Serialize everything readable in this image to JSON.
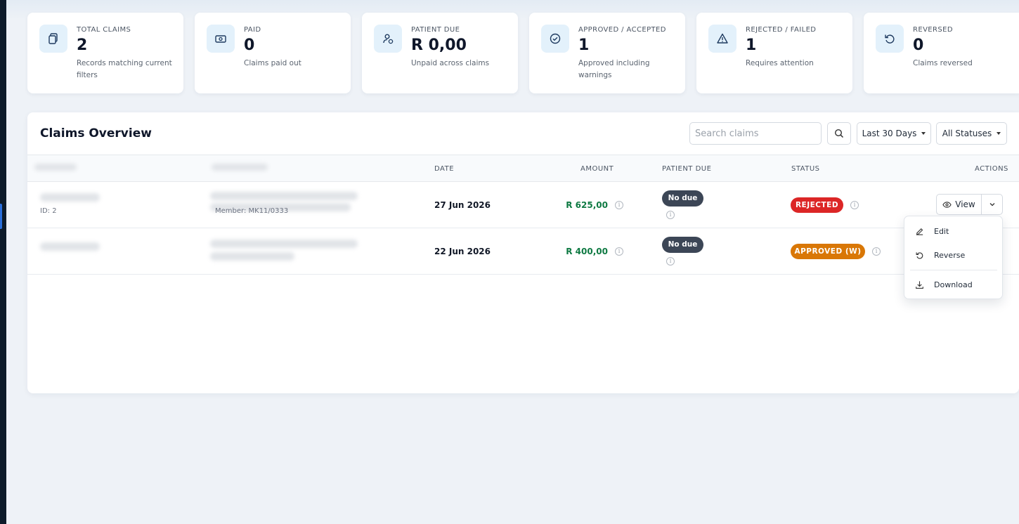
{
  "stats": [
    {
      "label": "TOTAL CLAIMS",
      "value": "2",
      "sub": "Records matching current filters",
      "icon": "copy-icon"
    },
    {
      "label": "PAID",
      "value": "0",
      "sub": "Claims paid out",
      "icon": "cash-icon"
    },
    {
      "label": "PATIENT DUE",
      "value": "R 0,00",
      "sub": "Unpaid across claims",
      "icon": "patient-icon"
    },
    {
      "label": "APPROVED / ACCEPTED",
      "value": "1",
      "sub": "Approved including warnings",
      "icon": "check-circle-icon"
    },
    {
      "label": "REJECTED / FAILED",
      "value": "1",
      "sub": "Requires attention",
      "icon": "warning-icon"
    },
    {
      "label": "REVERSED",
      "value": "0",
      "sub": "Claims reversed",
      "icon": "reverse-icon"
    }
  ],
  "panel": {
    "title": "Claims Overview",
    "search_placeholder": "Search claims",
    "date_filter": "Last 30 Days",
    "status_filter": "All Statuses"
  },
  "table": {
    "columns": {
      "date": "DATE",
      "amount": "AMOUNT",
      "patient_due": "PATIENT DUE",
      "status": "STATUS",
      "actions": "ACTIONS"
    },
    "rows": [
      {
        "id_text": "ID: 2",
        "member_text": "Member: MK11/0333",
        "date": "27 Jun 2026",
        "amount": "R 625,00",
        "patient_due": "No due",
        "status": "REJECTED",
        "status_color": "#dc2626"
      },
      {
        "id_text": "",
        "member_text": "",
        "date": "22 Jun 2026",
        "amount": "R 400,00",
        "patient_due": "No due",
        "status": "APPROVED (W)",
        "status_color": "#d97706"
      }
    ],
    "view_label": "View"
  },
  "menu": {
    "edit": "Edit",
    "reverse": "Reverse",
    "download": "Download"
  },
  "colors": {
    "amount": "#0f7a43",
    "accent": "#2a6fdb",
    "rejected": "#dc2626",
    "approved_w": "#d97706"
  }
}
